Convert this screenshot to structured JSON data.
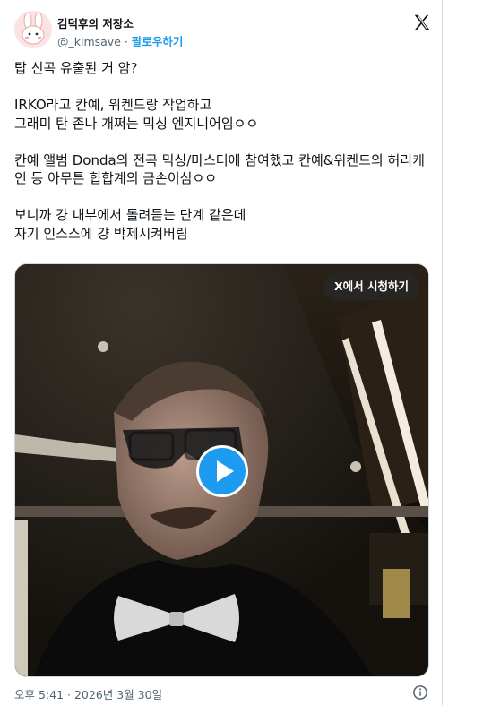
{
  "author": {
    "display_name": "김덕후의 저장소",
    "handle": "@_kimsave",
    "separator": "·",
    "follow_label": "팔로우하기",
    "avatar_icon": "bunny-avatar-icon"
  },
  "platform_icon": "x-logo-icon",
  "tweet": {
    "text": "탑 신곡 유출된 거 암?\n\nIRKO라고 칸예, 위켄드랑 작업하고\n그래미 탄 존나 개쩌는 믹싱 엔지니어임ㅇㅇ\n\n칸예 앨범 Donda의 전곡 믹싱/마스터에 참여했고 칸예&위켄드의 허리케인 등 아무튼 힙합계의 금손이심ㅇㅇ\n\n보니까 걍 내부에서 돌려듣는 단계 같은데\n자기 인스스에 걍 박제시켜버림"
  },
  "media": {
    "watch_on_x_label": "X에서 시청하기",
    "play_icon": "play-icon"
  },
  "footer": {
    "timestamp": "오후 5:41 · 2026년 3월 30일",
    "info_icon": "info-icon"
  },
  "colors": {
    "accent": "#1d9bf0",
    "text": "#0f1419",
    "secondary": "#536471",
    "border": "#cfd9de"
  }
}
